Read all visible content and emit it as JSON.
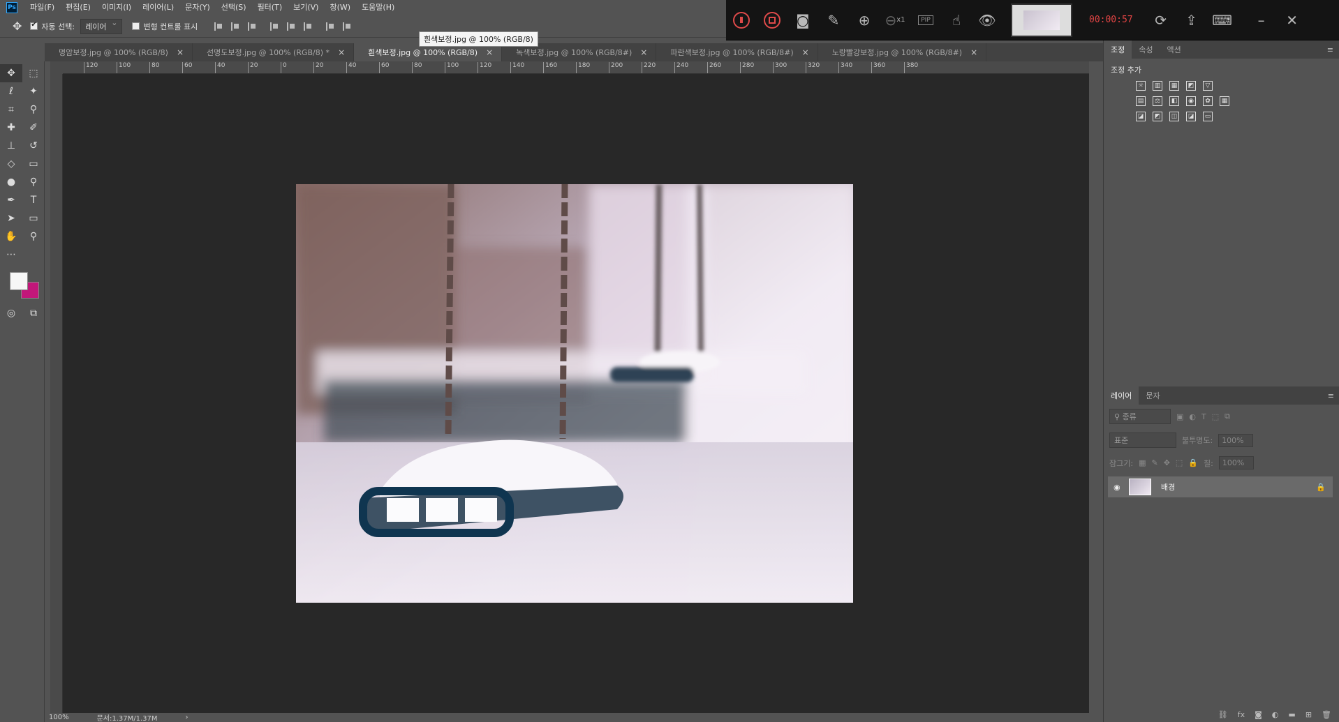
{
  "menu": [
    "파일(F)",
    "편집(E)",
    "이미지(I)",
    "레이어(L)",
    "문자(Y)",
    "선택(S)",
    "필터(T)",
    "보기(V)",
    "창(W)",
    "도움말(H)"
  ],
  "recorder": {
    "timer": "00:00:57",
    "zoom_label": "x1",
    "pip_label": "PIP"
  },
  "options": {
    "auto_select_label": "자동 선택:",
    "auto_select_value": "레이어",
    "transform_label": "변형 컨트롤 표시"
  },
  "tooltip": "흰색보정.jpg @ 100% (RGB/8)",
  "tabs": [
    {
      "label": "명암보정.jpg @ 100% (RGB/8)",
      "active": false
    },
    {
      "label": "선명도보정.jpg @ 100% (RGB/8) *",
      "active": false
    },
    {
      "label": "흰색보정.jpg @ 100% (RGB/8)",
      "active": true
    },
    {
      "label": "녹색보정.jpg @ 100% (RGB/8#)",
      "active": false
    },
    {
      "label": "파란색보정.jpg @ 100% (RGB/8#)",
      "active": false
    },
    {
      "label": "노랑빨강보정.jpg @ 100% (RGB/8#)",
      "active": false
    }
  ],
  "ruler_ticks": [
    "120",
    "100",
    "80",
    "60",
    "40",
    "20",
    "0",
    "20",
    "40",
    "60",
    "80",
    "100",
    "120",
    "140",
    "160",
    "180",
    "200",
    "220",
    "240",
    "260",
    "280",
    "300",
    "320",
    "340",
    "360",
    "380"
  ],
  "status": {
    "zoom": "100%",
    "doc": "문서:1.37M/1.37M"
  },
  "right_panel": {
    "tabs": [
      "조정",
      "속성",
      "액션"
    ],
    "adjust_title": "조정 추가",
    "layers_tabs": [
      "레이어",
      "문자"
    ],
    "kind_placeholder": "종류",
    "blend_mode": "표준",
    "opacity_label": "불투명도:",
    "opacity_value": "100%",
    "lock_label": "잠그기:",
    "fill_label": "칠:",
    "fill_value": "100%",
    "layer_name": "배경"
  },
  "colors": {
    "foreground": "#f7f7f7",
    "background": "#c2177a",
    "recorder_accent": "#e04a4a"
  }
}
